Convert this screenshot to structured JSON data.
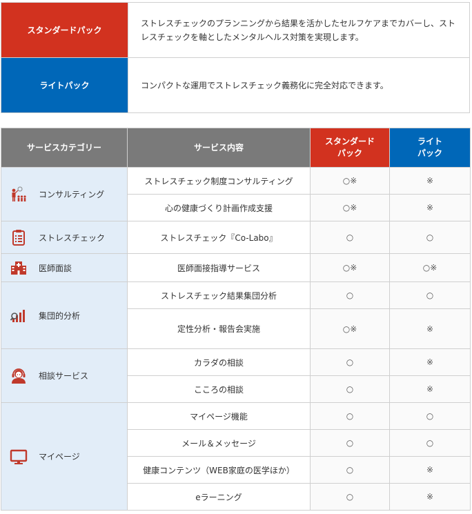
{
  "packs": [
    {
      "name": "スタンダードパック",
      "color": "#d2321f",
      "description": "ストレスチェックのプランニングから結果を活かしたセルフケアまでカバーし、ストレスチェックを軸としたメンタルヘルス対策を実現します。"
    },
    {
      "name": "ライトパック",
      "color": "#0067b8",
      "description": "コンパクトな運用でストレスチェック義務化に完全対応できます。"
    }
  ],
  "table": {
    "headers": {
      "category": "サービスカテゴリー",
      "content": "サービス内容",
      "standard_line1": "スタンダード",
      "standard_line2": "パック",
      "lite_line1": "ライト",
      "lite_line2": "パック"
    },
    "header_colors": {
      "gray": "#7a7a7a",
      "standard": "#d2321f",
      "lite": "#0067b8"
    },
    "categories": [
      {
        "label": "コンサルティング",
        "icon": "consultant-icon",
        "services": [
          {
            "name": "ストレスチェック制度コンサルティング",
            "standard": "○※",
            "lite": "※"
          },
          {
            "name": "心の健康づくり計画作成支援",
            "standard": "○※",
            "lite": "※"
          }
        ]
      },
      {
        "label": "ストレスチェック",
        "icon": "clipboard-checklist-icon",
        "services": [
          {
            "name": "ストレスチェック『Co-Labo』",
            "standard": "○",
            "lite": "○"
          }
        ]
      },
      {
        "label": "医師面談",
        "icon": "hospital-icon",
        "services": [
          {
            "name": "医師面接指導サービス",
            "standard": "○※",
            "lite": "○※"
          }
        ]
      },
      {
        "label": "集団的分析",
        "icon": "bar-chart-analysis-icon",
        "services": [
          {
            "name": "ストレスチェック結果集団分析",
            "standard": "○",
            "lite": "○"
          },
          {
            "name": "定性分析・報告会実施",
            "standard": "○※",
            "lite": "※"
          }
        ]
      },
      {
        "label": "相談サービス",
        "icon": "headset-operator-icon",
        "services": [
          {
            "name": "カラダの相談",
            "standard": "○",
            "lite": "※"
          },
          {
            "name": "こころの相談",
            "standard": "○",
            "lite": "※"
          }
        ]
      },
      {
        "label": "マイページ",
        "icon": "monitor-icon",
        "services": [
          {
            "name": "マイページ機能",
            "standard": "○",
            "lite": "○"
          },
          {
            "name": "メール＆メッセージ",
            "standard": "○",
            "lite": "○"
          },
          {
            "name": "健康コンテンツ（WEB家庭の医学ほか）",
            "standard": "○",
            "lite": "※"
          },
          {
            "name": "eラーニング",
            "standard": "○",
            "lite": "※"
          }
        ]
      }
    ]
  }
}
